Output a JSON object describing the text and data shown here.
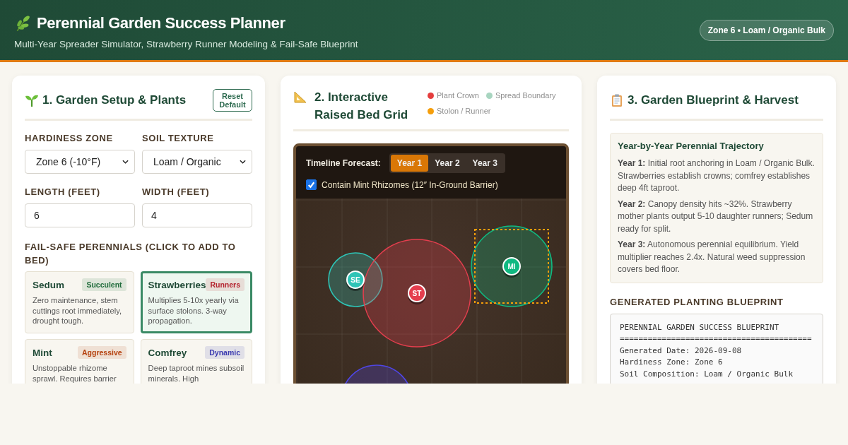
{
  "header": {
    "title": "Perennial Garden Success Planner",
    "subtitle": "Multi-Year Spreader Simulator, Strawberry Runner Modeling & Fail-Safe Blueprint",
    "badge": "Zone 6 • Loam / Organic Bulk"
  },
  "setup": {
    "title": "1. Garden Setup & Plants",
    "reset": "Reset Default",
    "fields": [
      {
        "kind": "select",
        "label": "HARDINESS ZONE",
        "value": "Zone 6 (-10°F)"
      },
      {
        "kind": "select",
        "label": "SOIL TEXTURE",
        "value": "Loam / Organic"
      },
      {
        "kind": "input",
        "label": "LENGTH (FEET)",
        "value": "6"
      },
      {
        "kind": "input",
        "label": "WIDTH (FEET)",
        "value": "4"
      }
    ],
    "plants_label": "FAIL-SAFE PERENNIALS (CLICK TO ADD TO BED)",
    "plants": [
      {
        "name": "Sedum",
        "tag": "Succulent",
        "color": "#1f6b3a",
        "description": "Zero maintenance, stem cuttings root immediately, drought tough.",
        "selected": false
      },
      {
        "name": "Strawberries",
        "tag": "Runners",
        "color": "#b3202c",
        "description": "Multiplies 5-10x yearly via surface stolons. 3-way propagation.",
        "selected": true
      },
      {
        "name": "Mint",
        "tag": "Aggressive",
        "color": "#b5400e",
        "description": "Unstoppable rhizome sprawl. Requires barrier",
        "selected": false
      },
      {
        "name": "Comfrey",
        "tag": "Dynamic",
        "color": "#3a3ab0",
        "description": "Deep taproot mines subsoil minerals. High",
        "selected": false
      }
    ]
  },
  "grid": {
    "title": "2. Interactive Raised Bed Grid",
    "legend": [
      {
        "label": "Plant Crown",
        "color": "#e53e3e"
      },
      {
        "label": "Spread Boundary",
        "color": "#a8d5c0"
      },
      {
        "label": "Stolon / Runner",
        "color": "#f59e0b"
      }
    ],
    "timeline_label": "Timeline Forecast:",
    "years": [
      {
        "label": "Year 1",
        "selected": true
      },
      {
        "label": "Year 2",
        "selected": false
      },
      {
        "label": "Year 3",
        "selected": false
      }
    ],
    "barrier": {
      "label": "Contain Mint Rhizomes (12″ In-Ground Barrier)",
      "checked": true
    },
    "bed_plants": [
      {
        "label": "SE",
        "color": "#2ec4b6"
      },
      {
        "label": "ST",
        "color": "#e53e4e"
      },
      {
        "label": "MI",
        "color": "#10b981"
      },
      {
        "color": "#4f46e5"
      }
    ]
  },
  "blueprint": {
    "title": "3. Garden Blueprint & Harvest",
    "trajectory_title": "Year-by-Year Perennial Trajectory",
    "trajectory": [
      {
        "year": "Year 1:",
        "text": "Initial root anchoring in Loam / Organic Bulk. Strawberries establish crowns; comfrey establishes deep 4ft taproot."
      },
      {
        "year": "Year 2:",
        "text": "Canopy density hits ~32%. Strawberry mother plants output 5-10 daughter runners; Sedum ready for split."
      },
      {
        "year": "Year 3:",
        "text": "Autonomous perennial equilibrium. Yield multiplier reaches 2.4x. Natural weed suppression covers bed floor."
      }
    ],
    "generated_label": "GENERATED PLANTING BLUEPRINT",
    "lines": [
      "PERENNIAL GARDEN SUCCESS BLUEPRINT",
      "=========================================",
      "Generated Date: 2026-09-08",
      "Hardiness Zone: Zone 6",
      "Soil Composition: Loam / Organic Bulk"
    ]
  }
}
